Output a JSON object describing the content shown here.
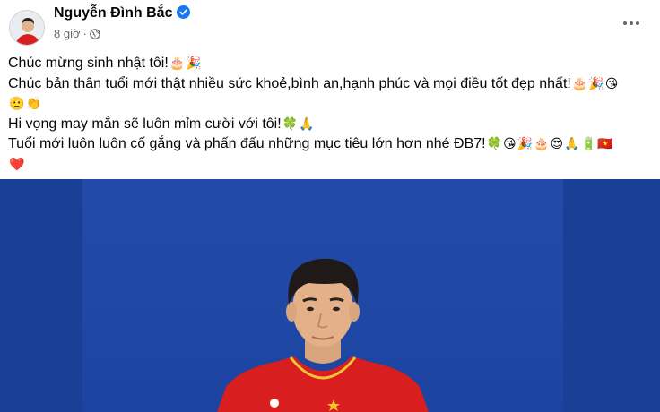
{
  "post": {
    "author": "Nguyễn Đình Bắc",
    "time": "8 giờ",
    "lines": {
      "l1": "Chúc mừng sinh nhật tôi!",
      "l2": "Chúc bản thân tuổi mới thật nhiều sức khoẻ,bình an,hạnh phúc và mọi điều tốt đẹp nhất!",
      "l4": "Hi vọng may mắn sẽ luôn mỉm cười với tôi!",
      "l5": "Tuổi mới luôn luôn cố gắng và phấn đấu những mục tiêu lớn hơn nhé ĐB7!"
    },
    "emoji": {
      "cake": "🎂",
      "party": "🎉",
      "kiss": "😘",
      "salute": "🫡",
      "clap": "👏",
      "clover": "🍀",
      "pray": "🙏",
      "heart_eyes": "😍",
      "battery": "🔋",
      "vn_flag": "🇻🇳",
      "heart": "❤️"
    }
  },
  "colors": {
    "verified": "#1877f2",
    "photo_bg": "#1f47a4",
    "jersey": "#d81e1e",
    "meta_text": "#65676b"
  }
}
